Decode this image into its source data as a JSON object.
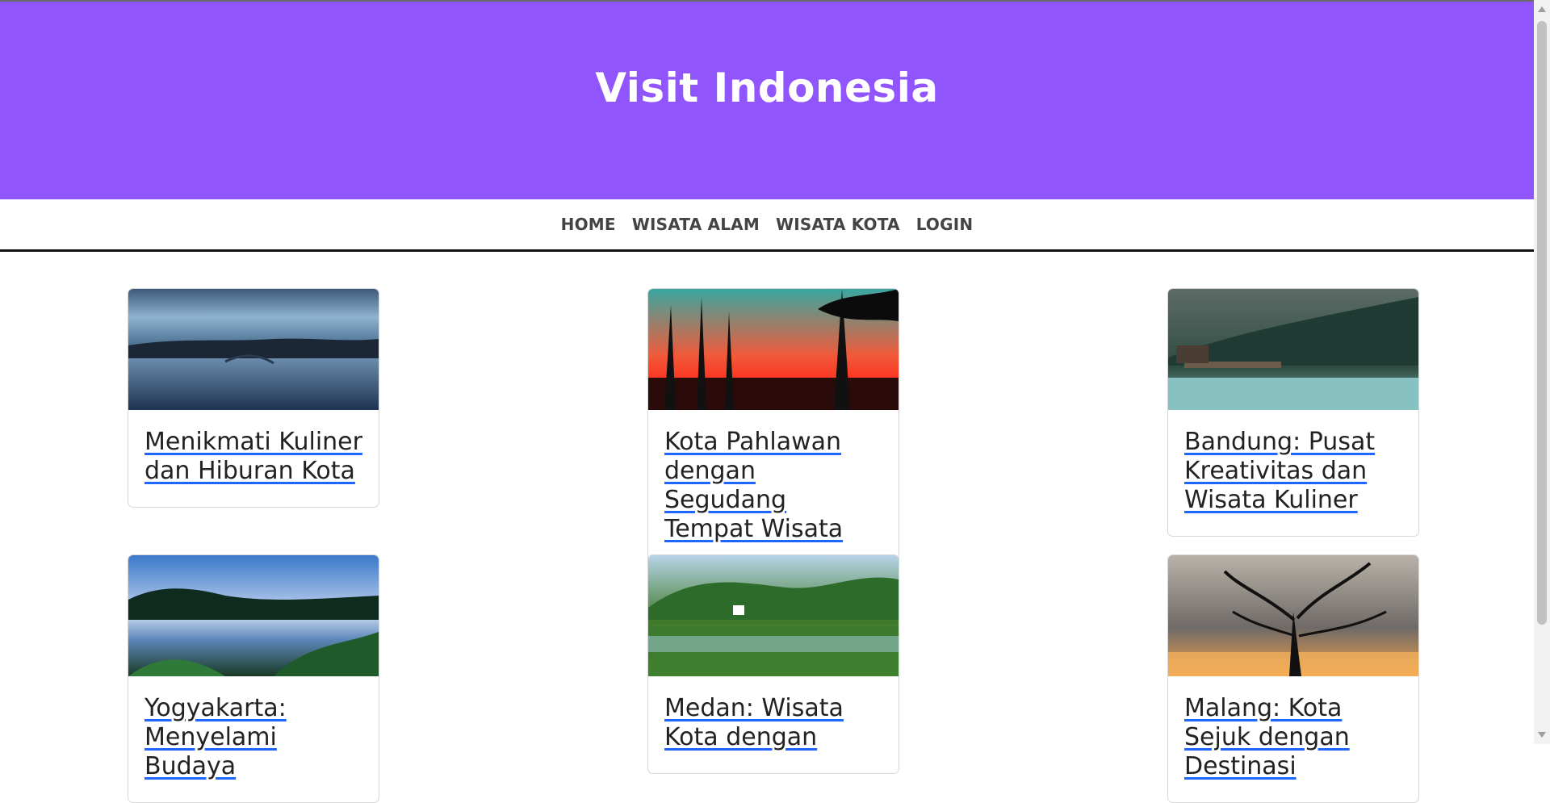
{
  "site": {
    "title": "Visit Indonesia"
  },
  "nav": {
    "items": [
      {
        "label": "HOME"
      },
      {
        "label": "WISATA ALAM"
      },
      {
        "label": "WISATA KOTA"
      },
      {
        "label": "LOGIN"
      }
    ]
  },
  "cards": [
    {
      "title": "Menikmati Kuliner dan Hiburan Kota",
      "image_icon": "lake-reflection-image"
    },
    {
      "title": "Kota Pahlawan dengan Segudang Tempat Wisata",
      "image_icon": "sunset-trees-image"
    },
    {
      "title": "Bandung: Pusat Kreativitas dan Wisata Kuliner",
      "image_icon": "mountain-lake-image"
    },
    {
      "title": "Yogyakarta: Menyelami Budaya",
      "image_icon": "blue-lake-image"
    },
    {
      "title": "Medan: Wisata Kota dengan",
      "image_icon": "valley-river-image"
    },
    {
      "title": "Malang: Kota Sejuk dengan Destinasi",
      "image_icon": "bare-tree-sunset-image"
    }
  ],
  "colors": {
    "hero_bg": "#9155fd",
    "link_underline": "#1e66ff",
    "nav_text": "#444444"
  }
}
